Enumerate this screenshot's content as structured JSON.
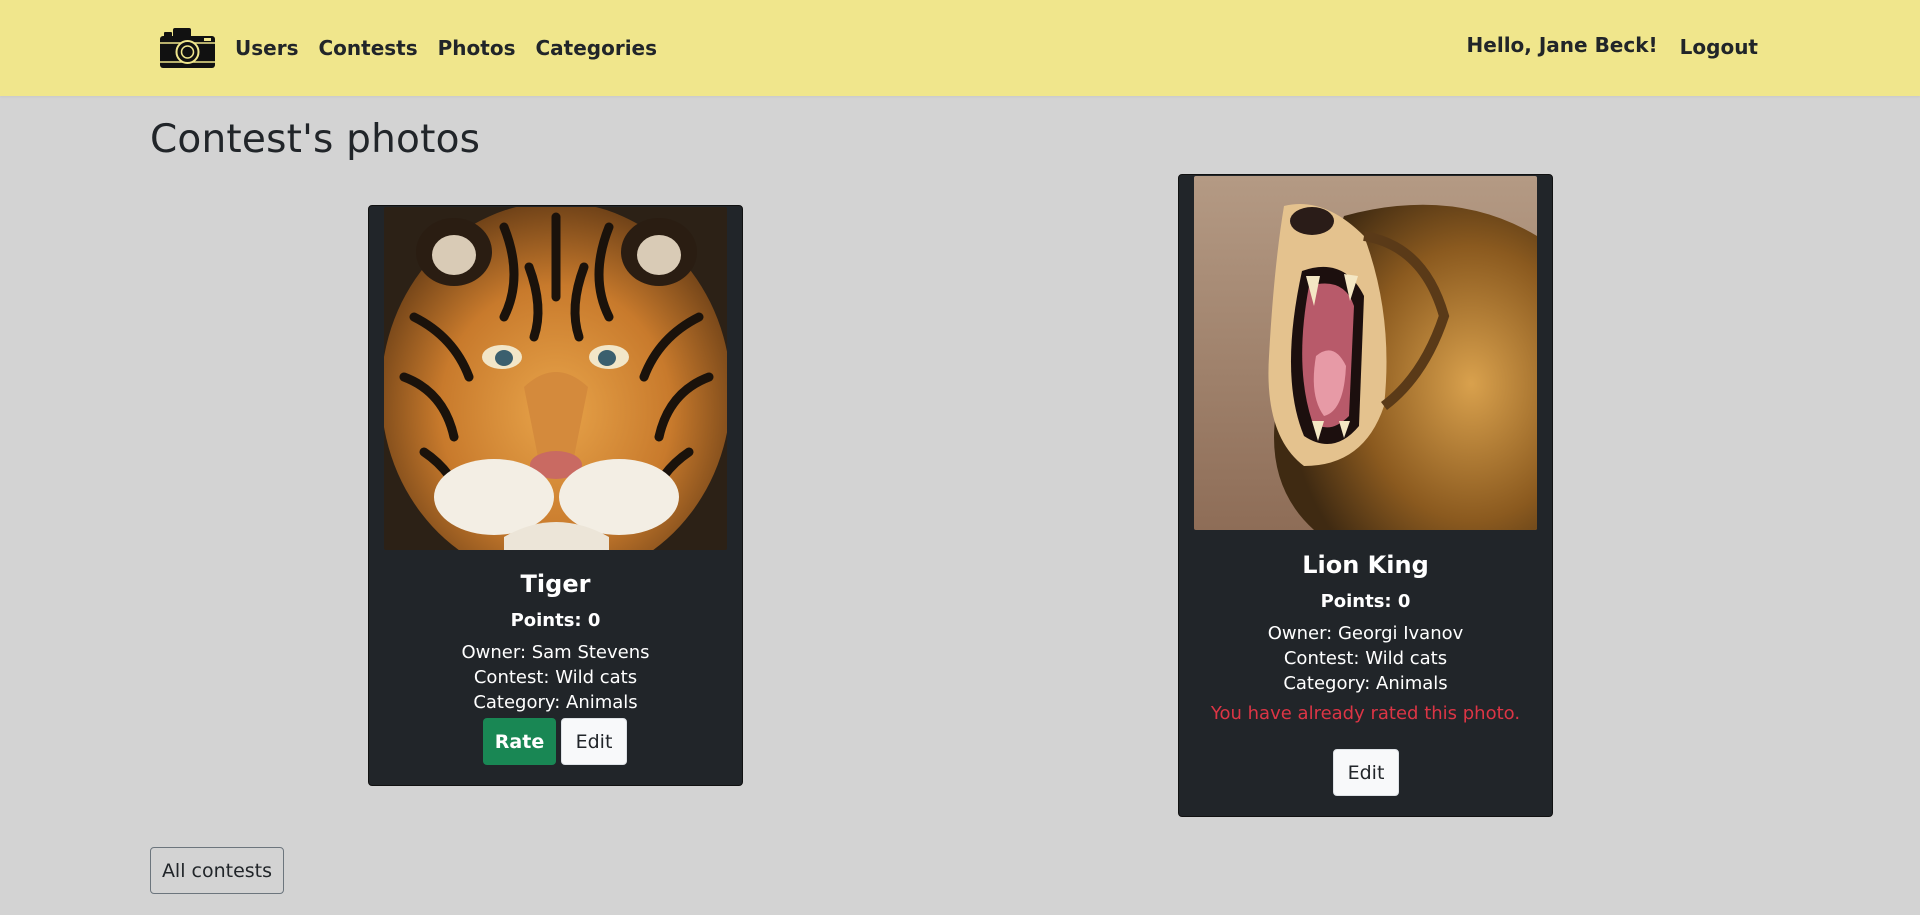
{
  "nav": {
    "links": [
      "Users",
      "Contests",
      "Photos",
      "Categories"
    ],
    "greeting": "Hello, Jane Beck!",
    "logout": "Logout",
    "colors": {
      "bar": "#f0e68c",
      "text": "#212529"
    }
  },
  "page": {
    "title": "Contest's photos",
    "background": "#d3d3d3"
  },
  "photos": [
    {
      "title": "Tiger",
      "points": "Points: 0",
      "owner": "Owner: Sam Stevens",
      "contest": "Contest: Wild cats",
      "category": "Category: Animals",
      "rate_label": "Rate",
      "edit_label": "Edit",
      "image": "tiger-photo"
    },
    {
      "title": "Lion King",
      "points": "Points: 0",
      "owner": "Owner: Georgi Ivanov",
      "contest": "Contest: Wild cats",
      "category": "Category: Animals",
      "rated_message": "You have already rated this photo.",
      "edit_label": "Edit",
      "image": "lion-photo"
    }
  ],
  "footer": {
    "all_contests": "All contests"
  },
  "colors": {
    "card_bg": "#212529",
    "rate_button": "#198754",
    "warning_text": "#dc3545"
  }
}
